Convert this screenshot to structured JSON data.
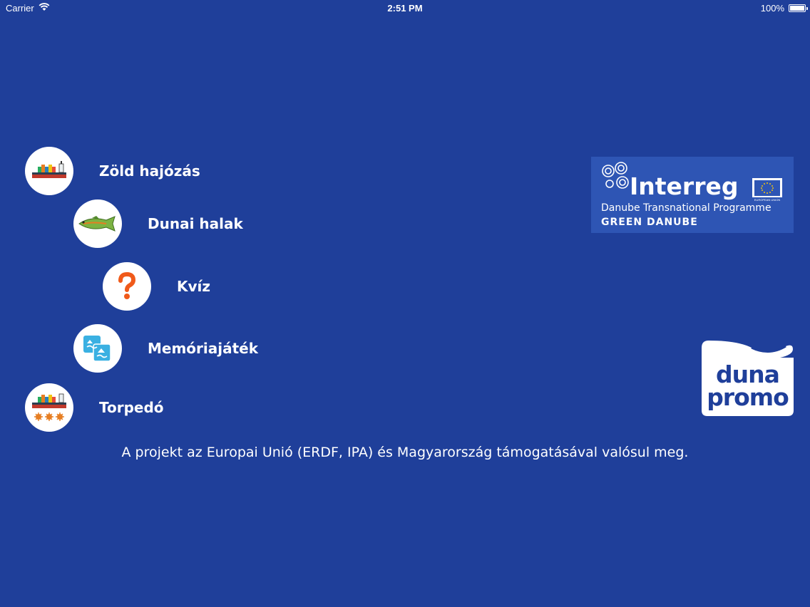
{
  "status_bar": {
    "carrier": "Carrier",
    "time": "2:51 PM",
    "battery": "100%"
  },
  "menu": {
    "items": [
      {
        "label": "Zöld hajózás",
        "icon": "ship-icon"
      },
      {
        "label": "Dunai halak",
        "icon": "fish-icon"
      },
      {
        "label": "Kvíz",
        "icon": "question-icon"
      },
      {
        "label": "Memóriajáték",
        "icon": "memory-cards-icon"
      },
      {
        "label": "Torpedó",
        "icon": "ship-mines-icon"
      }
    ]
  },
  "footer": {
    "text": "A projekt az Europai Unió (ERDF, IPA) és Magyarország támogatásával valósul meg."
  },
  "interreg_logo": {
    "title": "Interreg",
    "subtitle": "Danube Transnational Programme",
    "project": "GREEN DANUBE",
    "eu_caption": "EUROPEAN UNION"
  },
  "dunapromo_logo": {
    "word1": "duna",
    "word2": "promo"
  },
  "colors": {
    "background": "#1f3f9a",
    "logo_box": "#2e55b4",
    "quiz_orange": "#f05a1a",
    "memory_blue": "#3ab0e2"
  }
}
